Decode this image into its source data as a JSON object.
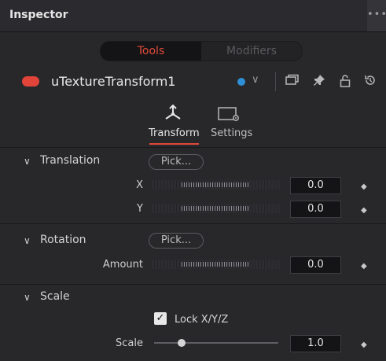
{
  "header": {
    "title": "Inspector",
    "more": "•••"
  },
  "tabs": {
    "tools": "Tools",
    "modifiers": "Modifiers"
  },
  "node": {
    "name": "uTextureTransform1",
    "chevron": "∨",
    "colors": {
      "node_dot": "#e3443a",
      "version_dot": "#2f8fd6"
    }
  },
  "subtabs": {
    "transform": "Transform",
    "settings": "Settings"
  },
  "translation": {
    "title": "Translation",
    "pick": "Pick...",
    "x_label": "X",
    "x_value": "0.0",
    "y_label": "Y",
    "y_value": "0.0"
  },
  "rotation": {
    "title": "Rotation",
    "pick": "Pick...",
    "amount_label": "Amount",
    "amount_value": "0.0"
  },
  "scale": {
    "title": "Scale",
    "lock_label": "Lock X/Y/Z",
    "lock_checked": true,
    "scale_label": "Scale",
    "scale_value": "1.0",
    "slider_fraction": 0.22
  },
  "icons": {
    "chevron_collapse": "∨",
    "keyframe": "◆",
    "check": "✓"
  },
  "accent": "#e04a3a"
}
